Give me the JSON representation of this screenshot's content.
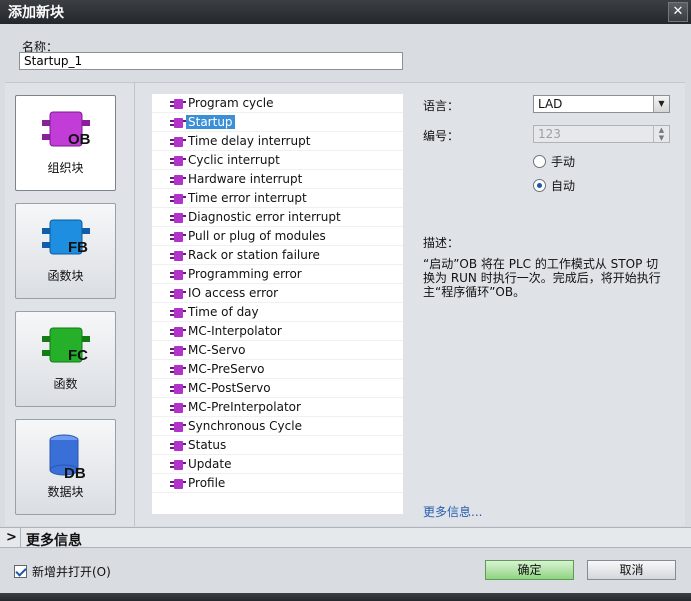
{
  "window": {
    "title": "添加新块",
    "close_glyph": "✕"
  },
  "name": {
    "label": "名称：",
    "value": "Startup_1"
  },
  "block_types": [
    {
      "icon_text": "OB",
      "label": "组织块",
      "color": "#c23cd8"
    },
    {
      "icon_text": "FB",
      "label": "函数块",
      "color": "#1e8fe0"
    },
    {
      "icon_text": "FC",
      "label": "函数",
      "color": "#26b02a"
    },
    {
      "icon_text": "DB",
      "label": "数据块",
      "color": "#3a6fd8"
    }
  ],
  "events": [
    "Program cycle",
    "Startup",
    "Time delay interrupt",
    "Cyclic interrupt",
    "Hardware interrupt",
    "Time error interrupt",
    "Diagnostic error interrupt",
    "Pull or plug of modules",
    "Rack or station failure",
    "Programming error",
    "IO access error",
    "Time of day",
    "MC-Interpolator",
    "MC-Servo",
    "MC-PreServo",
    "MC-PostServo",
    "MC-PreInterpolator",
    "Synchronous Cycle",
    "Status",
    "Update",
    "Profile"
  ],
  "selected_event": "Startup",
  "properties": {
    "language_label": "语言：",
    "language_value": "LAD",
    "number_label": "编号：",
    "number_value": "123",
    "manual_label": "手动",
    "auto_label": "自动",
    "selected_mode": "auto"
  },
  "description": {
    "label": "描述：",
    "text": "“启动”OB 将在 PLC 的工作模式从 STOP 切换为 RUN 时执行一次。完成后，将开始执行主“程序循环”OB。"
  },
  "more_info_link": "更多信息...",
  "more_info_bar": {
    "chevron": ">",
    "label": "更多信息"
  },
  "footer": {
    "add_open_label": "新增并打开(O)",
    "add_open_checked": true,
    "ok_label": "确定",
    "cancel_label": "取消"
  }
}
